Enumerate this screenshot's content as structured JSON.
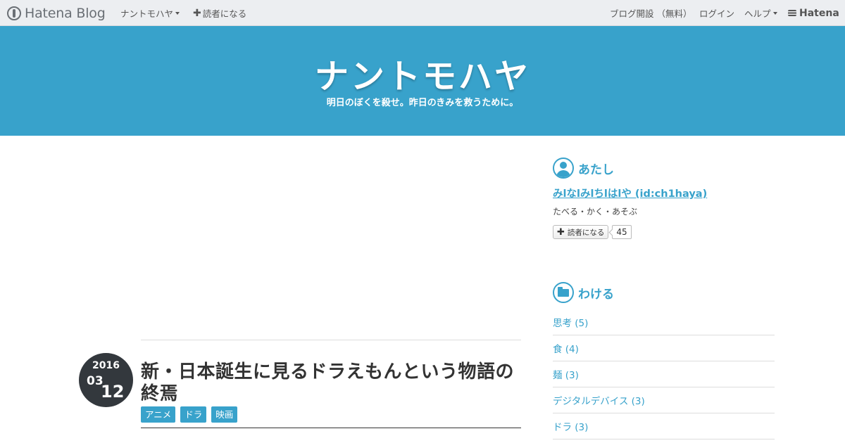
{
  "topbar": {
    "logo": "Hatena Blog",
    "blog_menu": "ナントモハヤ",
    "subscribe": "読者になる",
    "open_blog": "ブログ開設 （無料）",
    "login": "ログイン",
    "help": "ヘルプ",
    "hatena": "Hatena"
  },
  "header": {
    "title": "ナントモハヤ",
    "description": "明日のぼくを殺せ。昨日のきみを救うために。"
  },
  "entry": {
    "date": {
      "year": "2016",
      "month": "03",
      "day": "12"
    },
    "title": "新・日本誕生に見るドラえもんという物語の終焉",
    "tags": [
      "アニメ",
      "ドラ",
      "映画"
    ]
  },
  "sidebar": {
    "profile": {
      "heading": "あたし",
      "name": "みlなlみlちlはlや (id:ch1haya)",
      "description": "たべる・かく・あそぶ",
      "subscribe_label": "読者になる",
      "subscriber_count": "45"
    },
    "categories": {
      "heading": "わける",
      "items": [
        "思考 (5)",
        "食 (4)",
        "麺 (3)",
        "デジタルデバイス (3)",
        "ドラ (3)"
      ]
    }
  },
  "colors": {
    "accent": "#38a2cb",
    "topbar_bg": "#eceef1",
    "date_badge": "#33383d"
  },
  "icons": [
    "hatena-blog-logo-icon",
    "caret-down-icon",
    "plus-icon",
    "hatena-logo-icon",
    "user-icon",
    "folder-icon"
  ]
}
